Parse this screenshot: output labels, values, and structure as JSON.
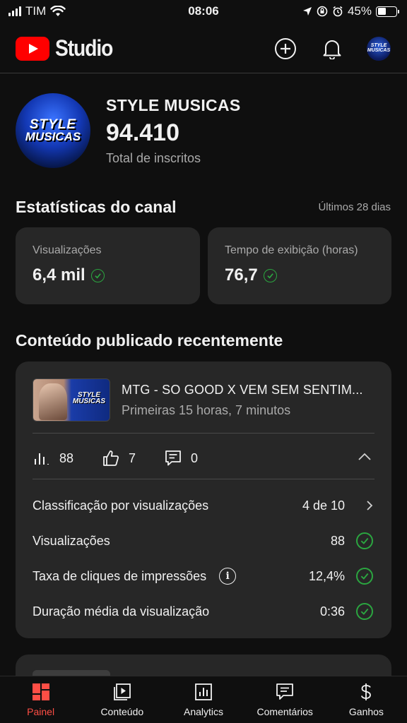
{
  "status_bar": {
    "carrier": "TIM",
    "time": "08:06",
    "battery": "45%",
    "battery_level": 0.45
  },
  "header": {
    "app_name": "Studio"
  },
  "channel": {
    "avatar_line1": "STYLE",
    "avatar_line2": "MUSICAS",
    "name": "STYLE MUSICAS",
    "subscribers": "94.410",
    "subscribers_label": "Total de inscritos"
  },
  "stats": {
    "title": "Estatísticas do canal",
    "range": "Últimos 28 dias",
    "views_label": "Visualizações",
    "views_value": "6,4 mil",
    "watch_label": "Tempo de exibição (horas)",
    "watch_value": "76,7"
  },
  "recent": {
    "title": "Conteúdo publicado recentemente",
    "video_title": "MTG - SO GOOD X VEM SEM SENTIM...",
    "video_subtitle": "Primeiras 15 horas, 7 minutos",
    "thumb_brand_1": "STYLE",
    "thumb_brand_2": "MUSICAS",
    "views": "88",
    "likes": "7",
    "comments": "0",
    "details": [
      {
        "label": "Classificação por visualizações",
        "value": "4 de 10"
      },
      {
        "label": "Visualizações",
        "value": "88"
      },
      {
        "label": "Taxa de cliques de impressões",
        "value": "12,4%"
      },
      {
        "label": "Duração média da visualização",
        "value": "0:36"
      }
    ]
  },
  "nav": {
    "items": [
      {
        "label": "Painel",
        "active": true
      },
      {
        "label": "Conteúdo"
      },
      {
        "label": "Analytics"
      },
      {
        "label": "Comentários"
      },
      {
        "label": "Ganhos"
      }
    ],
    "active_color": "#ff4e45"
  },
  "colors": {
    "background": "#0f0f0f",
    "card": "#272727",
    "brand_red": "#ff0000",
    "check_green": "#2ba640",
    "secondary_text": "#aaaaaa"
  }
}
